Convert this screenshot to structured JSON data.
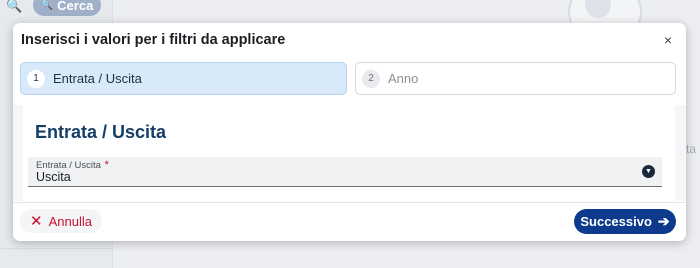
{
  "background": {
    "search_button_label": "Cerca",
    "side_text": "ta"
  },
  "modal": {
    "title": "Inserisci i valori per i filtri da applicare",
    "close_glyph": "×",
    "steps": [
      {
        "number": "1",
        "label": "Entrata / Uscita",
        "active": true
      },
      {
        "number": "2",
        "label": "Anno",
        "active": false
      }
    ],
    "section_title": "Entrata / Uscita",
    "field": {
      "label": "Entrata / Uscita",
      "required_marker": "*",
      "value": "Uscita"
    },
    "footer": {
      "cancel_label": "Annulla",
      "next_label": "Successivo"
    }
  },
  "colors": {
    "primary": "#0d3a8c",
    "danger": "#c8102e",
    "step_active_bg": "#d8eaf9",
    "section_title": "#153f66"
  },
  "icons": {
    "search": "search-icon",
    "close": "close-icon",
    "cancel": "close-x-icon",
    "next": "arrow-right-icon",
    "dropdown": "chevron-down-icon"
  }
}
